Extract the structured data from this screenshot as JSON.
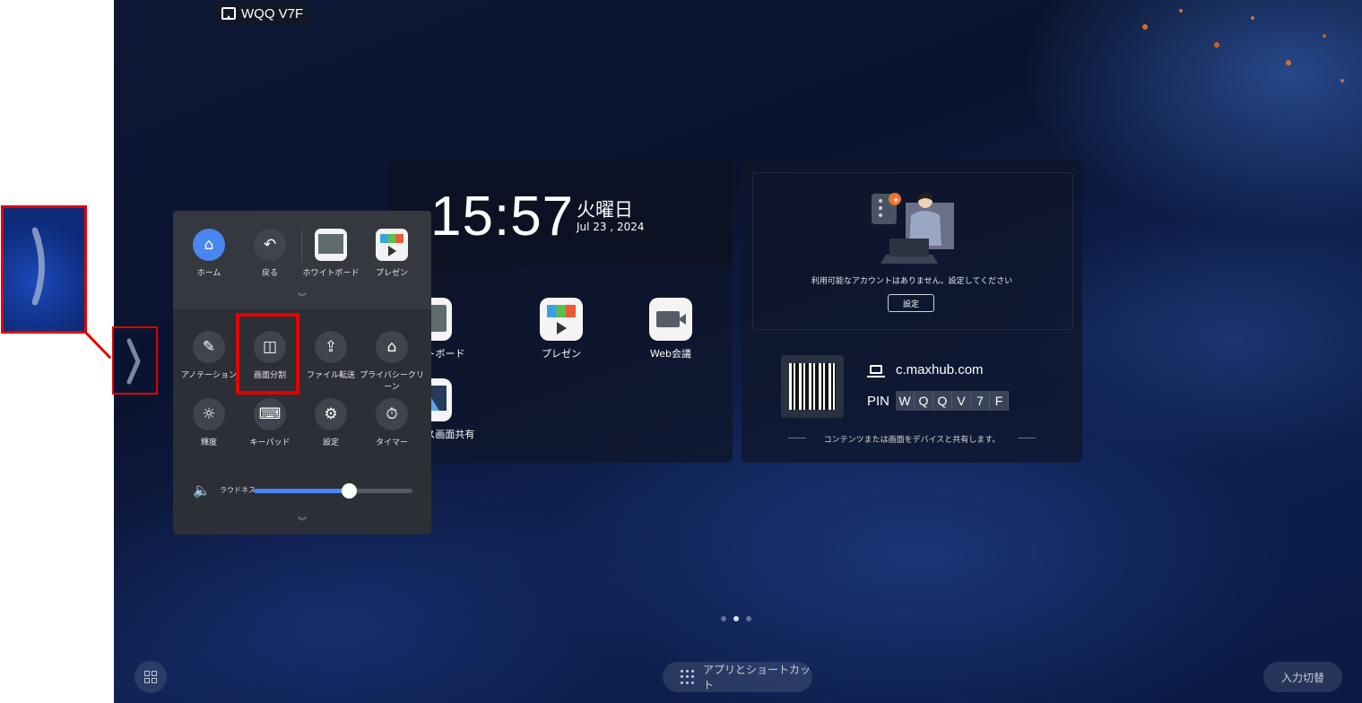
{
  "device_name": "WQQ V7F",
  "clock": {
    "time": "15:57",
    "weekday": "火曜日",
    "date": "Jul 23 , 2024"
  },
  "apps": [
    {
      "label": "ホワイトボード",
      "icon": "whiteboard-icon"
    },
    {
      "label": "プレゼン",
      "icon": "presentation-icon"
    },
    {
      "label": "Web会議",
      "icon": "video-camera-icon"
    },
    {
      "label": "ワイヤレス画面共有",
      "icon": "wireless-share-icon"
    }
  ],
  "account": {
    "message": "利用可能なアカウントはありません。設定してください",
    "settings_label": "設定"
  },
  "connect": {
    "url": "c.maxhub.com",
    "pin_label": "PIN",
    "pin_chars": [
      "W",
      "Q",
      "Q",
      "V",
      "7",
      "F"
    ],
    "share_text": "コンテンツまたは画面をデバイスと共有します。"
  },
  "quick_panel": {
    "top_items": [
      {
        "label": "ホーム",
        "icon": "home-icon"
      },
      {
        "label": "戻る",
        "icon": "back-icon"
      },
      {
        "label": "ホワイトボード",
        "icon": "whiteboard-icon"
      },
      {
        "label": "プレゼン",
        "icon": "presentation-icon"
      }
    ],
    "tools": [
      {
        "label": "アノテーション",
        "icon": "pen-icon"
      },
      {
        "label": "画面分割",
        "icon": "split-screen-icon"
      },
      {
        "label": "ファイル転送",
        "icon": "file-transfer-icon"
      },
      {
        "label": "プライバシークリーン",
        "icon": "privacy-clean-icon"
      },
      {
        "label": "輝度",
        "icon": "brightness-icon"
      },
      {
        "label": "キーパッド",
        "icon": "keyboard-icon"
      },
      {
        "label": "設定",
        "icon": "settings-icon"
      },
      {
        "label": "タイマー",
        "icon": "timer-icon"
      }
    ],
    "volume_label": "ラウドネス",
    "volume_level": 0.6
  },
  "bottom": {
    "apps_label": "アプリとショートカット",
    "input_label": "入力切替"
  },
  "page_indicator": {
    "count": 3,
    "active": 1
  },
  "colors": {
    "accent": "#4a86f0",
    "highlight": "#e60000"
  }
}
